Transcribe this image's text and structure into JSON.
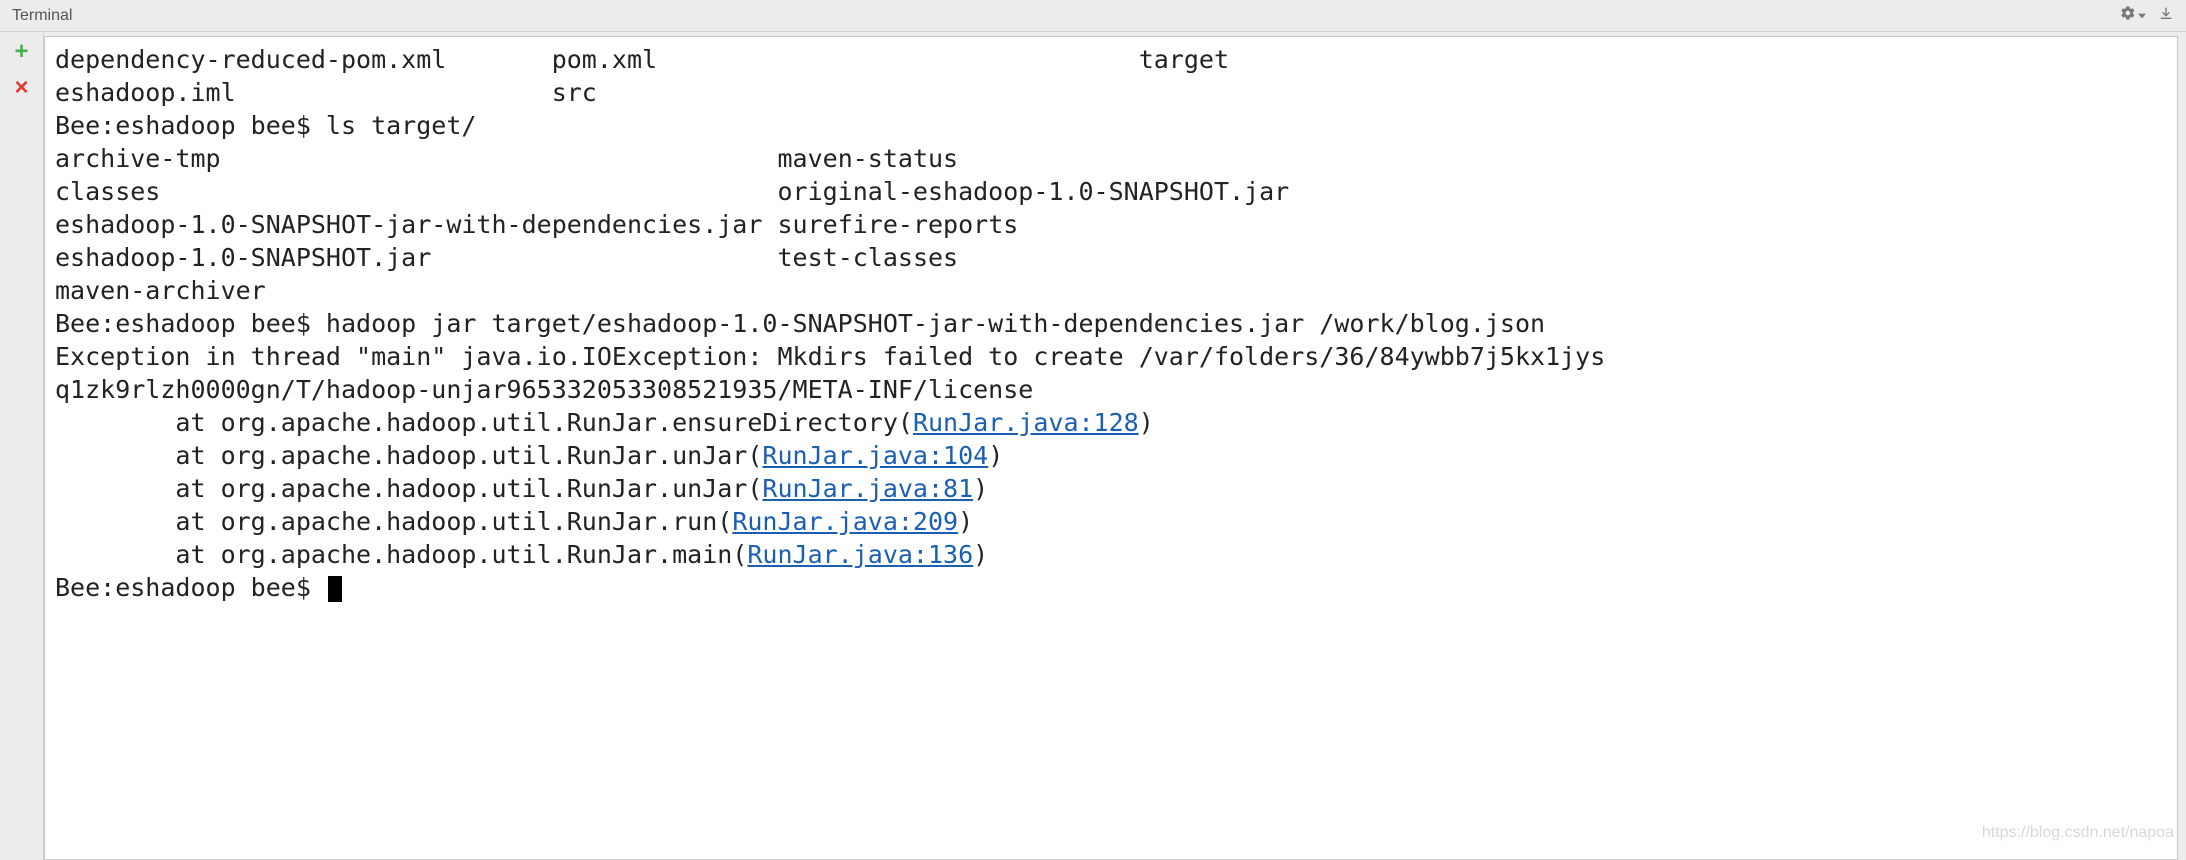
{
  "header": {
    "title": "Terminal"
  },
  "terminal": {
    "line1_col1": "dependency-reduced-pom.xml",
    "line1_col2": "pom.xml",
    "line1_col3": "target",
    "line2_col1": "eshadoop.iml",
    "line2_col2": "src",
    "prompt1": "Bee:eshadoop bee$ ls target/",
    "ls_line1_col1": "archive-tmp",
    "ls_line1_col2": "maven-status",
    "ls_line2_col1": "classes",
    "ls_line2_col2": "original-eshadoop-1.0-SNAPSHOT.jar",
    "ls_line3_col1": "eshadoop-1.0-SNAPSHOT-jar-with-dependencies.jar",
    "ls_line3_col2": "surefire-reports",
    "ls_line4_col1": "eshadoop-1.0-SNAPSHOT.jar",
    "ls_line4_col2": "test-classes",
    "ls_line5": "maven-archiver",
    "prompt2": "Bee:eshadoop bee$ hadoop jar target/eshadoop-1.0-SNAPSHOT-jar-with-dependencies.jar /work/blog.json",
    "exception_line1": "Exception in thread \"main\" java.io.IOException: Mkdirs failed to create /var/folders/36/84ywbb7j5kx1jys",
    "exception_line2": "q1zk9rlzh0000gn/T/hadoop-unjar965332053308521935/META-INF/license",
    "stack1_prefix": "        at org.apache.hadoop.util.RunJar.ensureDirectory(",
    "stack1_link": "RunJar.java:128",
    "stack1_suffix": ")",
    "stack2_prefix": "        at org.apache.hadoop.util.RunJar.unJar(",
    "stack2_link": "RunJar.java:104",
    "stack2_suffix": ")",
    "stack3_prefix": "        at org.apache.hadoop.util.RunJar.unJar(",
    "stack3_link": "RunJar.java:81",
    "stack3_suffix": ")",
    "stack4_prefix": "        at org.apache.hadoop.util.RunJar.run(",
    "stack4_link": "RunJar.java:209",
    "stack4_suffix": ")",
    "stack5_prefix": "        at org.apache.hadoop.util.RunJar.main(",
    "stack5_link": "RunJar.java:136",
    "stack5_suffix": ")",
    "prompt3": "Bee:eshadoop bee$ "
  },
  "watermark": "https://blog.csdn.net/napoa"
}
